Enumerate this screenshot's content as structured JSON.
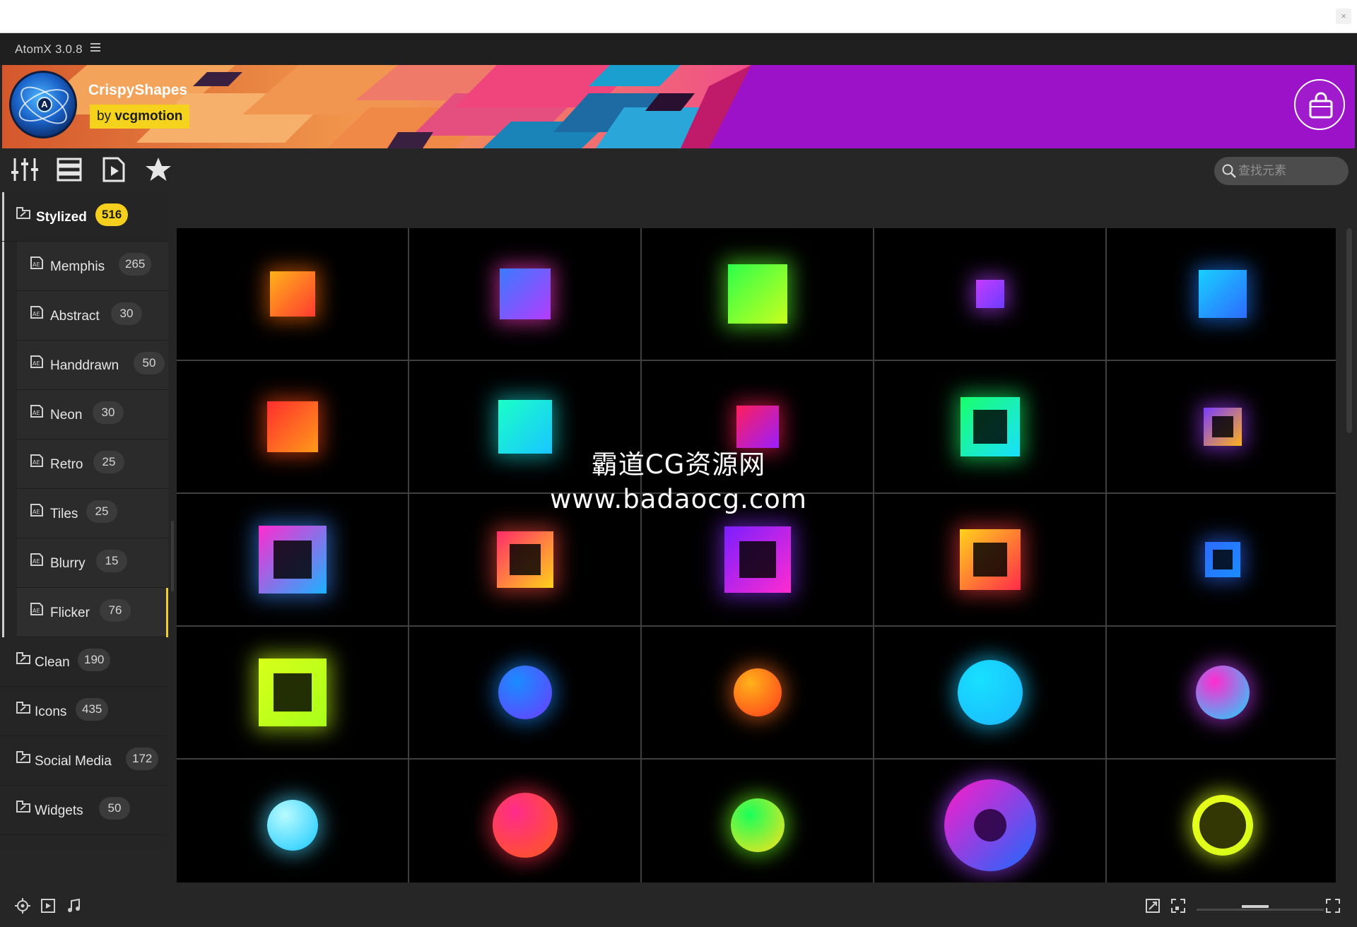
{
  "app": {
    "title": "AtomX 3.0.8"
  },
  "banner": {
    "brand": "CrispyShapes",
    "by_prefix": "by",
    "by_author": "vcgmotion"
  },
  "search": {
    "placeholder": "查找元素"
  },
  "toolbar": {
    "icons": [
      "sliders-icon",
      "list-view-icon",
      "preview-icon",
      "favorites-star-icon"
    ]
  },
  "sidebar": {
    "categories": [
      {
        "label": "Stylized",
        "count": "516",
        "expanded": true,
        "active": true
      },
      {
        "label": "Clean",
        "count": "190"
      },
      {
        "label": "Icons",
        "count": "435"
      },
      {
        "label": "Social Media",
        "count": "172"
      },
      {
        "label": "Widgets",
        "count": "50"
      }
    ],
    "subcategories": [
      {
        "label": "Memphis",
        "count": "265"
      },
      {
        "label": "Abstract",
        "count": "30"
      },
      {
        "label": "Handdrawn",
        "count": "50"
      },
      {
        "label": "Neon",
        "count": "30"
      },
      {
        "label": "Retro",
        "count": "25"
      },
      {
        "label": "Tiles",
        "count": "25"
      },
      {
        "label": "Blurry",
        "count": "15"
      },
      {
        "label": "Flicker",
        "count": "76",
        "active": true
      }
    ]
  },
  "thumbnails": [
    {
      "shape": "square",
      "colors": [
        "#ffb21a",
        "#ff3b2f"
      ],
      "glow": "#ff6a00"
    },
    {
      "shape": "square",
      "colors": [
        "#3a7bff",
        "#b43cff"
      ],
      "glow": "#ff3cc8"
    },
    {
      "shape": "square",
      "colors": [
        "#2dff4a",
        "#c8ff1e"
      ],
      "glow": "#59ff2a"
    },
    {
      "shape": "square",
      "colors": [
        "#c43cff",
        "#6c3cff"
      ],
      "glow": "#b43cff"
    },
    {
      "shape": "square",
      "colors": [
        "#18d0ff",
        "#2d6bff"
      ],
      "glow": "#1e7bff"
    },
    {
      "shape": "square",
      "colors": [
        "#ff2e2e",
        "#ff9a1a"
      ],
      "glow": "#ff4a14"
    },
    {
      "shape": "square",
      "colors": [
        "#1affc8",
        "#19c6ff"
      ],
      "glow": "#19d2d2"
    },
    {
      "shape": "square",
      "colors": [
        "#ff1e5a",
        "#9a1eff"
      ],
      "glow": "#ff1e5a"
    },
    {
      "shape": "hollow-square",
      "colors": [
        "#19ff6a",
        "#19e0ff"
      ],
      "glow": "#19ff6a"
    },
    {
      "shape": "hollow-square",
      "colors": [
        "#7a3cff",
        "#ffb21a"
      ],
      "glow": "#a23cff"
    },
    {
      "shape": "hollow-square",
      "colors": [
        "#ff2bd0",
        "#1ab2ff"
      ],
      "glow": "#3c8cff"
    },
    {
      "shape": "hollow-square",
      "colors": [
        "#ff2b6a",
        "#ffd21a"
      ],
      "glow": "#ff4a3c"
    },
    {
      "shape": "hollow-square",
      "colors": [
        "#7a1eff",
        "#ff2bd0"
      ],
      "glow": "#8a2bff"
    },
    {
      "shape": "hollow-square",
      "colors": [
        "#ffd21a",
        "#ff2b4a"
      ],
      "glow": "#ff3c3c"
    },
    {
      "shape": "hollow-square",
      "colors": [
        "#2d6bff",
        "#1a8cff"
      ],
      "glow": "#2d6bff"
    },
    {
      "shape": "hollow-square",
      "colors": [
        "#d8ff1a",
        "#a8ff1a"
      ],
      "glow": "#c8ff1a"
    },
    {
      "shape": "circle",
      "colors": [
        "#1a8cff",
        "#6a3cff"
      ],
      "glow": "#1a8cff"
    },
    {
      "shape": "circle",
      "colors": [
        "#ffb21a",
        "#ff3b1a"
      ],
      "glow": "#ff6a1a"
    },
    {
      "shape": "circle",
      "colors": [
        "#18e0ff",
        "#1ab8ff"
      ],
      "glow": "#18c8ff"
    },
    {
      "shape": "circle",
      "colors": [
        "#ff2bd0",
        "#1ad8ff"
      ],
      "glow": "#c83cff"
    },
    {
      "shape": "circle",
      "colors": [
        "#b8fbff",
        "#18c8ff"
      ],
      "glow": "#4ad8ff"
    },
    {
      "shape": "circle",
      "colors": [
        "#ff2b8a",
        "#ff5a1a"
      ],
      "glow": "#ff2b4a"
    },
    {
      "shape": "circle",
      "colors": [
        "#18ff5a",
        "#ffe21a"
      ],
      "glow": "#6aff1a"
    },
    {
      "shape": "ring-thick",
      "colors": [
        "#ff1ac8",
        "#1a6aff"
      ],
      "glow": "#a23cff"
    },
    {
      "shape": "ring-thin",
      "colors": [
        "#e8ff1a",
        "#d8ff1a"
      ],
      "glow": "#d8ff1a"
    }
  ],
  "watermark": {
    "line1": "霸道CG资源网",
    "line2": "www.badaocg.com"
  },
  "statusbar": {
    "left_icons": [
      "target-icon",
      "video-icon",
      "music-icon"
    ],
    "right_icons": [
      "fit-icon",
      "expand-icon",
      "fullscreen-icon"
    ],
    "zoom": 0.45
  }
}
